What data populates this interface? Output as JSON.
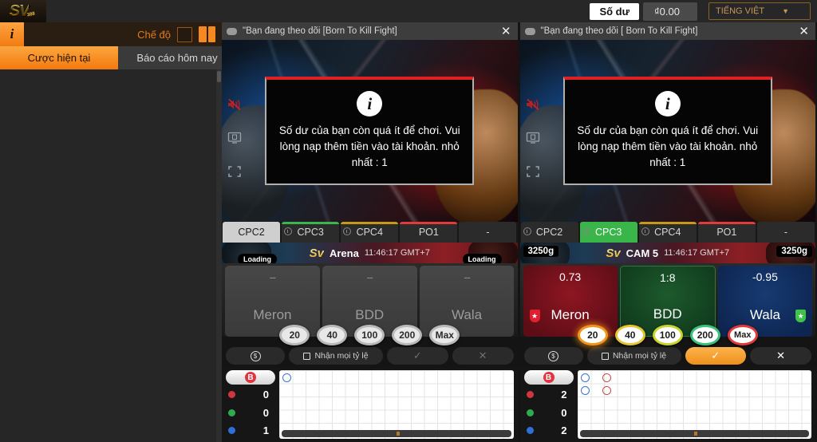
{
  "header": {
    "logo_text": "SV",
    "logo_sub": "388",
    "balance_label": "Số dư",
    "balance_value": "₫0.00",
    "language": "TIẾNG VIỆT",
    "caret_icon": "chevron-down-icon"
  },
  "sidebar": {
    "info_icon": "info-icon",
    "mode_label": "Chế độ",
    "mode_single_icon": "single-pane-icon",
    "mode_dual_icon": "dual-pane-icon",
    "tabs": [
      {
        "label": "Cược hiện tại",
        "active": true
      },
      {
        "label": "Báo cáo hôm nay",
        "active": false
      }
    ]
  },
  "panels": [
    {
      "title": "\"Bạn đang theo dõi [Born To Kill Fight]",
      "close_icon": "close-icon",
      "video": {
        "mute_icon": "speaker-muted-icon",
        "quality_icon": "screen-quality-icon",
        "fullscreen_icon": "fullscreen-icon",
        "modal_icon": "info-icon",
        "modal_text": "Số dư của bạn còn quá ít để chơi. Vui lòng nạp thêm tiền vào tài khoản. nhỏ nhất : 1"
      },
      "cams": [
        {
          "label": "CPC2",
          "state": "selected-white",
          "bar": "none"
        },
        {
          "label": "CPC3",
          "state": "normal",
          "bar": "#3cb54a"
        },
        {
          "label": "CPC4",
          "state": "normal",
          "bar": "#c79a14"
        },
        {
          "label": "PO1",
          "state": "normal",
          "bar": "#e23b3b"
        },
        {
          "label": "-",
          "state": "normal",
          "bar": "none"
        }
      ],
      "arena": {
        "sv": "Sv",
        "name": "Arena",
        "time": "11:46:17 GMT+7",
        "weight_left": "",
        "weight_right": "",
        "loading_left": "Loading",
        "loading_right": "Loading"
      },
      "bets": [
        {
          "name": "Meron",
          "odds": "--",
          "style": "off"
        },
        {
          "name": "BDD",
          "odds": "--",
          "style": "off"
        },
        {
          "name": "Wala",
          "odds": "--",
          "style": "off"
        }
      ],
      "chips": [
        {
          "label": "20",
          "color": "gray"
        },
        {
          "label": "40",
          "color": "gray"
        },
        {
          "label": "100",
          "color": "gray"
        },
        {
          "label": "200",
          "color": "gray"
        },
        {
          "label": "Max",
          "color": "gray"
        }
      ],
      "actions": {
        "coin_icon": "coin-icon",
        "accept_all_label": "Nhận mọi tỷ lệ",
        "confirm_icon": "check-icon",
        "cancel_icon": "close-icon",
        "confirm_active": false
      },
      "scoreboard": {
        "badge": "B",
        "rows": [
          {
            "color": "r",
            "count": "0"
          },
          {
            "color": "g",
            "count": "0"
          },
          {
            "color": "b",
            "count": "1"
          }
        ],
        "marks": [
          {
            "col": 0,
            "row": 0,
            "color": "blue"
          }
        ]
      }
    },
    {
      "title": "\"Bạn đang theo dõi [ Born To Kill Fight]",
      "close_icon": "close-icon",
      "video": {
        "mute_icon": "speaker-muted-icon",
        "quality_icon": "screen-quality-icon",
        "fullscreen_icon": "fullscreen-icon",
        "modal_icon": "info-icon",
        "modal_text": "Số dư của bạn còn quá ít để chơi. Vui lòng nạp thêm tiền vào tài khoản. nhỏ nhất : 1"
      },
      "cams": [
        {
          "label": "CPC2",
          "state": "normal",
          "bar": "none"
        },
        {
          "label": "CPC3",
          "state": "selected-green",
          "bar": "#3cb54a"
        },
        {
          "label": "CPC4",
          "state": "normal",
          "bar": "#c79a14"
        },
        {
          "label": "PO1",
          "state": "normal",
          "bar": "#e23b3b"
        },
        {
          "label": "-",
          "state": "normal",
          "bar": "none"
        }
      ],
      "arena": {
        "sv": "Sv",
        "name": "CAM 5",
        "time": "11:46:17 GMT+7",
        "weight_left": "3250g",
        "weight_right": "3250g",
        "loading_left": "",
        "loading_right": ""
      },
      "bets": [
        {
          "name": "Meron",
          "odds": "0.73",
          "style": "meron"
        },
        {
          "name": "BDD",
          "odds": "1:8",
          "style": "bdd"
        },
        {
          "name": "Wala",
          "odds": "-0.95",
          "style": "wala"
        }
      ],
      "chips": [
        {
          "label": "20",
          "color": "c20"
        },
        {
          "label": "40",
          "color": "c40"
        },
        {
          "label": "100",
          "color": "c100"
        },
        {
          "label": "200",
          "color": "c200"
        },
        {
          "label": "Max",
          "color": "cmax"
        }
      ],
      "actions": {
        "coin_icon": "coin-icon",
        "accept_all_label": "Nhận mọi tỷ lệ",
        "confirm_icon": "check-icon",
        "cancel_icon": "close-icon",
        "confirm_active": true
      },
      "scoreboard": {
        "badge": "B",
        "rows": [
          {
            "color": "r",
            "count": "2"
          },
          {
            "color": "g",
            "count": "0"
          },
          {
            "color": "b",
            "count": "2"
          }
        ],
        "marks": [
          {
            "col": 0,
            "row": 0,
            "color": "blue"
          },
          {
            "col": 0,
            "row": 1,
            "color": "blue"
          },
          {
            "col": 1,
            "row": 0,
            "color": "red"
          },
          {
            "col": 1,
            "row": 1,
            "color": "red"
          }
        ]
      }
    }
  ],
  "colors": {
    "accent": "#f5881f",
    "meron": "#8e1622",
    "bdd": "#1d5a2c",
    "wala": "#163a72"
  }
}
